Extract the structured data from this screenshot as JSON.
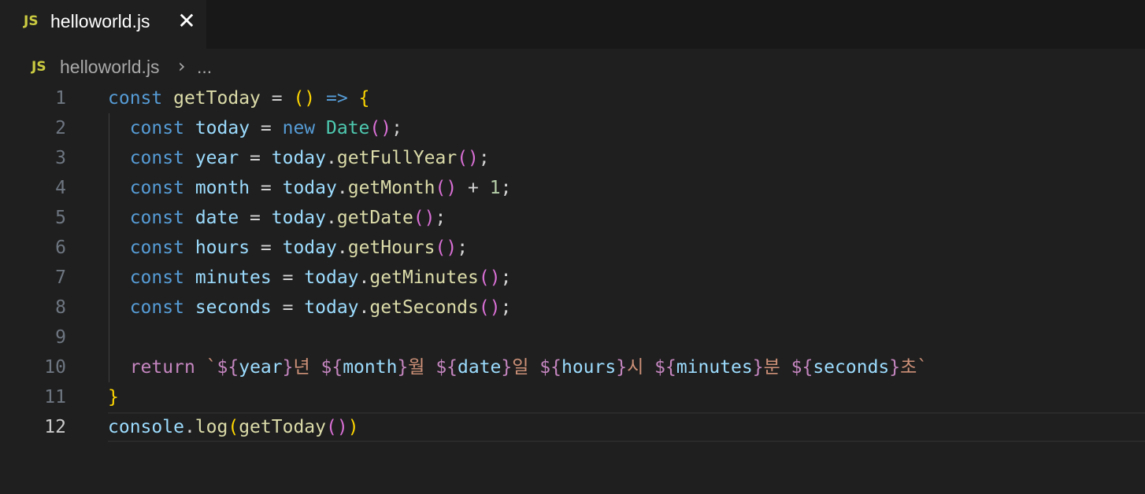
{
  "tab": {
    "badge": "JS",
    "label": "helloworld.js",
    "close": "✕"
  },
  "breadcrumb": {
    "badge": "JS",
    "file": "helloworld.js",
    "separator": "›",
    "more": "..."
  },
  "editor": {
    "active_line": 12,
    "line_numbers": [
      "1",
      "2",
      "3",
      "4",
      "5",
      "6",
      "7",
      "8",
      "9",
      "10",
      "11",
      "12"
    ],
    "lines": [
      [
        [
          "kw",
          "const"
        ],
        [
          "op",
          " "
        ],
        [
          "fn",
          "getToday"
        ],
        [
          "op",
          " = "
        ],
        [
          "br1",
          "()"
        ],
        [
          "op",
          " "
        ],
        [
          "kw",
          "=>"
        ],
        [
          "op",
          " "
        ],
        [
          "br1",
          "{"
        ]
      ],
      [
        [
          "op",
          "  "
        ],
        [
          "kw",
          "const"
        ],
        [
          "op",
          " "
        ],
        [
          "var",
          "today"
        ],
        [
          "op",
          " = "
        ],
        [
          "kw",
          "new"
        ],
        [
          "op",
          " "
        ],
        [
          "cls",
          "Date"
        ],
        [
          "br2",
          "()"
        ],
        [
          "punc",
          ";"
        ]
      ],
      [
        [
          "op",
          "  "
        ],
        [
          "kw",
          "const"
        ],
        [
          "op",
          " "
        ],
        [
          "var",
          "year"
        ],
        [
          "op",
          " = "
        ],
        [
          "var",
          "today"
        ],
        [
          "punc",
          "."
        ],
        [
          "fn",
          "getFullYear"
        ],
        [
          "br2",
          "()"
        ],
        [
          "punc",
          ";"
        ]
      ],
      [
        [
          "op",
          "  "
        ],
        [
          "kw",
          "const"
        ],
        [
          "op",
          " "
        ],
        [
          "var",
          "month"
        ],
        [
          "op",
          " = "
        ],
        [
          "var",
          "today"
        ],
        [
          "punc",
          "."
        ],
        [
          "fn",
          "getMonth"
        ],
        [
          "br2",
          "()"
        ],
        [
          "op",
          " + "
        ],
        [
          "num",
          "1"
        ],
        [
          "punc",
          ";"
        ]
      ],
      [
        [
          "op",
          "  "
        ],
        [
          "kw",
          "const"
        ],
        [
          "op",
          " "
        ],
        [
          "var",
          "date"
        ],
        [
          "op",
          " = "
        ],
        [
          "var",
          "today"
        ],
        [
          "punc",
          "."
        ],
        [
          "fn",
          "getDate"
        ],
        [
          "br2",
          "()"
        ],
        [
          "punc",
          ";"
        ]
      ],
      [
        [
          "op",
          "  "
        ],
        [
          "kw",
          "const"
        ],
        [
          "op",
          " "
        ],
        [
          "var",
          "hours"
        ],
        [
          "op",
          " = "
        ],
        [
          "var",
          "today"
        ],
        [
          "punc",
          "."
        ],
        [
          "fn",
          "getHours"
        ],
        [
          "br2",
          "()"
        ],
        [
          "punc",
          ";"
        ]
      ],
      [
        [
          "op",
          "  "
        ],
        [
          "kw",
          "const"
        ],
        [
          "op",
          " "
        ],
        [
          "var",
          "minutes"
        ],
        [
          "op",
          " = "
        ],
        [
          "var",
          "today"
        ],
        [
          "punc",
          "."
        ],
        [
          "fn",
          "getMinutes"
        ],
        [
          "br2",
          "()"
        ],
        [
          "punc",
          ";"
        ]
      ],
      [
        [
          "op",
          "  "
        ],
        [
          "kw",
          "const"
        ],
        [
          "op",
          " "
        ],
        [
          "var",
          "seconds"
        ],
        [
          "op",
          " = "
        ],
        [
          "var",
          "today"
        ],
        [
          "punc",
          "."
        ],
        [
          "fn",
          "getSeconds"
        ],
        [
          "br2",
          "()"
        ],
        [
          "punc",
          ";"
        ]
      ],
      [],
      [
        [
          "op",
          "  "
        ],
        [
          "ctl",
          "return"
        ],
        [
          "op",
          " "
        ],
        [
          "str",
          "`"
        ],
        [
          "tpl",
          "${"
        ],
        [
          "var",
          "year"
        ],
        [
          "tpl",
          "}"
        ],
        [
          "str",
          "년 "
        ],
        [
          "tpl",
          "${"
        ],
        [
          "var",
          "month"
        ],
        [
          "tpl",
          "}"
        ],
        [
          "str",
          "월 "
        ],
        [
          "tpl",
          "${"
        ],
        [
          "var",
          "date"
        ],
        [
          "tpl",
          "}"
        ],
        [
          "str",
          "일 "
        ],
        [
          "tpl",
          "${"
        ],
        [
          "var",
          "hours"
        ],
        [
          "tpl",
          "}"
        ],
        [
          "str",
          "시 "
        ],
        [
          "tpl",
          "${"
        ],
        [
          "var",
          "minutes"
        ],
        [
          "tpl",
          "}"
        ],
        [
          "str",
          "분 "
        ],
        [
          "tpl",
          "${"
        ],
        [
          "var",
          "seconds"
        ],
        [
          "tpl",
          "}"
        ],
        [
          "str",
          "초`"
        ]
      ],
      [
        [
          "br1",
          "}"
        ]
      ],
      [
        [
          "var",
          "console"
        ],
        [
          "punc",
          "."
        ],
        [
          "fn",
          "log"
        ],
        [
          "br1",
          "("
        ],
        [
          "fn",
          "getToday"
        ],
        [
          "br2",
          "()"
        ],
        [
          "br1",
          ")"
        ]
      ]
    ]
  }
}
